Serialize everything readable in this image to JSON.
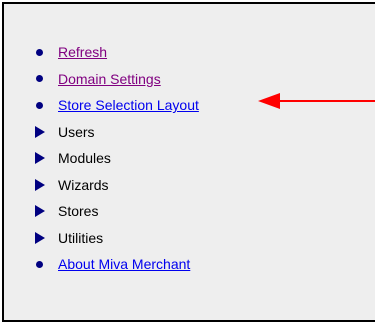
{
  "menu": {
    "items": [
      {
        "label": "Refresh",
        "kind": "link",
        "icon": "bullet-icon",
        "color": "#800080"
      },
      {
        "label": "Domain Settings",
        "kind": "link",
        "icon": "bullet-icon",
        "color": "#800080"
      },
      {
        "label": "Store Selection Layout",
        "kind": "link",
        "icon": "bullet-icon",
        "color": "#0000ee"
      },
      {
        "label": "Users",
        "kind": "expander",
        "icon": "triangle-icon"
      },
      {
        "label": "Modules",
        "kind": "expander",
        "icon": "triangle-icon"
      },
      {
        "label": "Wizards",
        "kind": "expander",
        "icon": "triangle-icon"
      },
      {
        "label": "Stores",
        "kind": "expander",
        "icon": "triangle-icon"
      },
      {
        "label": "Utilities",
        "kind": "expander",
        "icon": "triangle-icon"
      },
      {
        "label": "About Miva Merchant",
        "kind": "link",
        "icon": "bullet-icon",
        "color": "#0000ee"
      }
    ]
  },
  "annotation": {
    "icon": "red-arrow-icon",
    "color": "#ff0000",
    "points_to": "Store Selection Layout"
  },
  "colors": {
    "bullet": "#000080",
    "panel_background": "#eeeeee",
    "visited_link": "#800080",
    "link": "#0000ee"
  }
}
